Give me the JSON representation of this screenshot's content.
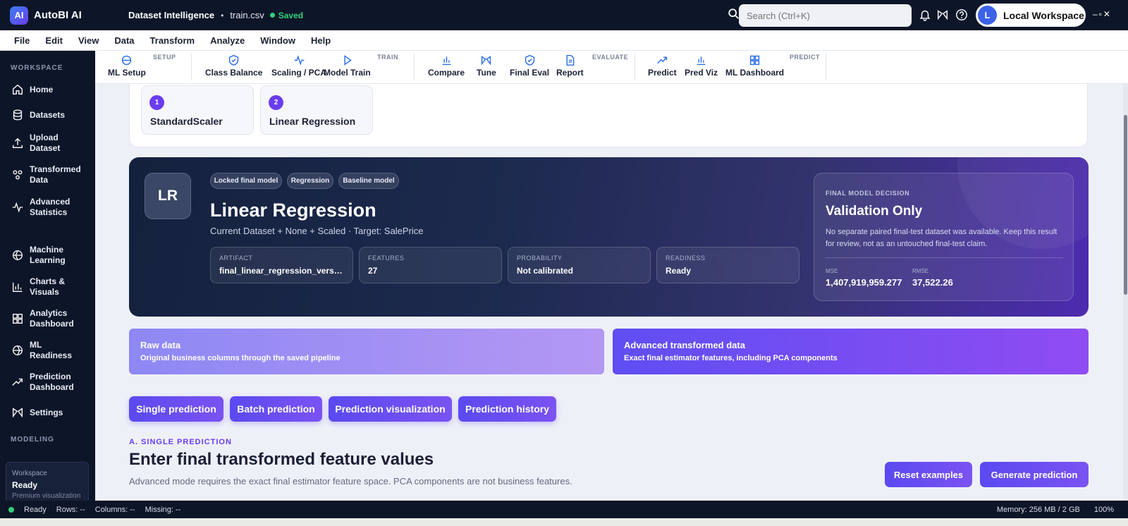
{
  "titlebar": {
    "logo_text": "AI",
    "app_name": "AutoBI AI",
    "doc_title": "Dataset Intelligence",
    "separator": "•",
    "file_name": "train.csv",
    "saved_label": "Saved",
    "search_placeholder": "Search (Ctrl+K)",
    "avatar_letter": "L",
    "workspace_name": "Local Workspace",
    "window_controls": "–▫✕"
  },
  "menu": [
    "File",
    "Edit",
    "View",
    "Data",
    "Transform",
    "Analyze",
    "Window",
    "Help"
  ],
  "sidebar": {
    "section_workspace": "WORKSPACE",
    "section_modeling": "MODELING",
    "items": [
      {
        "label": "Home",
        "icon": "home-icon"
      },
      {
        "label": "Datasets",
        "icon": "database-icon"
      },
      {
        "label": "Upload Dataset",
        "icon": "upload-icon"
      },
      {
        "label": "Transformed Data",
        "icon": "transform-icon"
      },
      {
        "label": "Advanced Statistics",
        "icon": "pulse-icon"
      },
      {
        "label": "Machine Learning",
        "icon": "ml-icon"
      },
      {
        "label": "Charts & Visuals",
        "icon": "bar-chart-icon"
      },
      {
        "label": "Analytics Dashboard",
        "icon": "dashboard-icon"
      },
      {
        "label": "ML Readiness",
        "icon": "readiness-icon"
      },
      {
        "label": "Prediction Dashboard",
        "icon": "trend-icon"
      },
      {
        "label": "Settings",
        "icon": "settings-icon"
      }
    ],
    "status_card": {
      "label": "Workspace",
      "value": "Ready",
      "note": "Premium visualization"
    }
  },
  "ribbon": {
    "groups": {
      "setup": "SETUP",
      "train": "TRAIN",
      "evaluate": "EVALUATE",
      "predict": "PREDICT"
    },
    "buttons": {
      "ml_setup": "ML Setup",
      "class_balance": "Class Balance",
      "scaling_pca": "Scaling / PCA",
      "model_train": "Model Train",
      "compare": "Compare",
      "tune": "Tune",
      "final_eval": "Final Eval",
      "report": "Report",
      "predict": "Predict",
      "pred_viz": "Pred Viz",
      "ml_dashboard": "ML Dashboard"
    }
  },
  "pipeline_steps": [
    {
      "number": "1",
      "label": "StandardScaler"
    },
    {
      "number": "2",
      "label": "Linear Regression"
    }
  ],
  "model": {
    "avatar": "LR",
    "tags": [
      "Locked final model",
      "Regression",
      "Baseline model"
    ],
    "title": "Linear Regression",
    "subtitle": "Current Dataset + None + Scaled · Target: SalePrice",
    "metrics": [
      {
        "label": "ARTIFACT",
        "value": "final_linear_regression_version_..."
      },
      {
        "label": "FEATURES",
        "value": "27"
      },
      {
        "label": "PROBABILITY",
        "value": "Not calibrated"
      },
      {
        "label": "READINESS",
        "value": "Ready"
      }
    ],
    "decision": {
      "label": "FINAL MODEL DECISION",
      "title": "Validation Only",
      "description": "No separate paired final-test dataset was available. Keep this result for review, not as an untouched final-test claim.",
      "stats": [
        {
          "label": "MSE",
          "value": "1,407,919,959.277"
        },
        {
          "label": "RMSE",
          "value": "37,522.26"
        }
      ]
    }
  },
  "modes": [
    {
      "title": "Raw data",
      "description": "Original business columns through the saved pipeline"
    },
    {
      "title": "Advanced transformed data",
      "description": "Exact final estimator features, including PCA components"
    }
  ],
  "tabs": [
    "Single prediction",
    "Batch prediction",
    "Prediction visualization",
    "Prediction history"
  ],
  "section": {
    "label": "A. SINGLE PREDICTION",
    "title": "Enter final transformed feature values",
    "description": "Advanced mode requires the exact final estimator feature space. PCA components are not business features.",
    "reset_label": "Reset examples",
    "generate_label": "Generate prediction"
  },
  "statusbar": {
    "ready": "Ready",
    "rows": "Rows: --",
    "columns": "Columns: --",
    "missing": "Missing: --",
    "memory": "Memory: 256 MB / 2 GB",
    "zoom": "100%"
  },
  "colors": {
    "accent": "#6a3df0",
    "saved": "#32d17a",
    "sidebar_bg": "#0d1628"
  }
}
